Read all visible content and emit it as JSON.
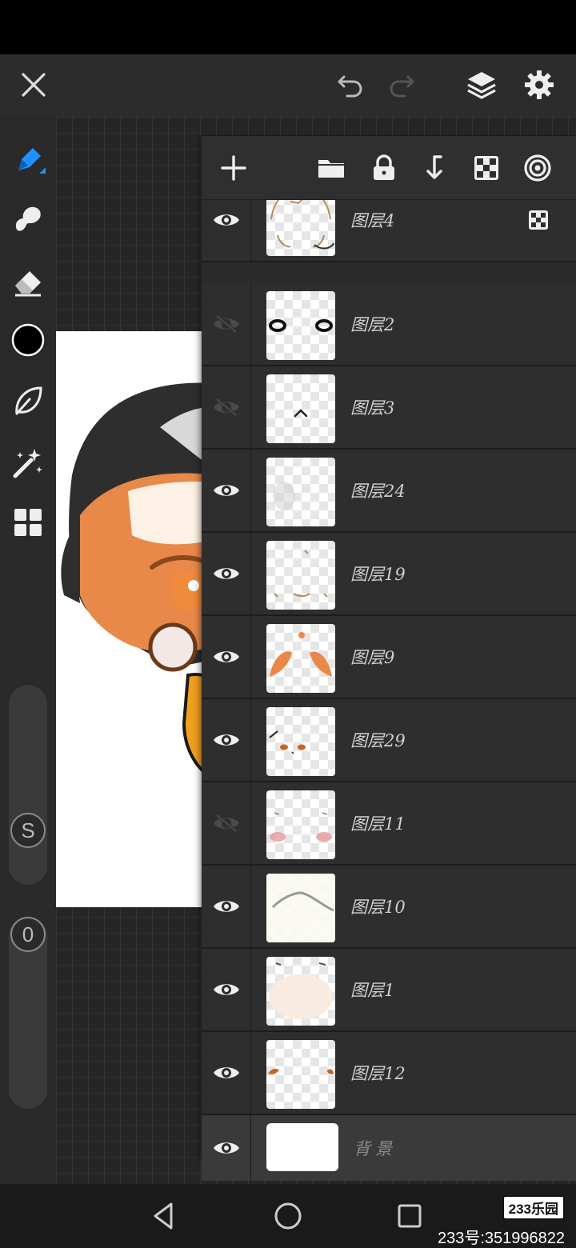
{
  "header": {
    "close_icon": "close-icon",
    "undo_icon": "undo-icon",
    "redo_icon": "redo-icon",
    "layers_icon": "layers-icon",
    "settings_icon": "gear-icon"
  },
  "tools": [
    "pen-icon",
    "smudge-icon",
    "eraser-icon",
    "color-swatch",
    "lasso-leaf-icon",
    "magic-wand-icon",
    "grid-icon"
  ],
  "brush_color": "#000000",
  "sliders": {
    "size_badge": "S",
    "opacity_badge": "0"
  },
  "layer_toolbar": [
    "add-icon",
    "folder-icon",
    "lock-icon",
    "merge-down-icon",
    "transparency-icon",
    "blend-icon"
  ],
  "layers": [
    {
      "name": "图层4",
      "visible": true
    },
    {
      "name": "图层2",
      "visible": false
    },
    {
      "name": "图层3",
      "visible": false
    },
    {
      "name": "图层24",
      "visible": true
    },
    {
      "name": "图层19",
      "visible": true
    },
    {
      "name": "图层9",
      "visible": true
    },
    {
      "name": "图层29",
      "visible": true
    },
    {
      "name": "图层11",
      "visible": false
    },
    {
      "name": "图层10",
      "visible": true
    },
    {
      "name": "图层1",
      "visible": true
    },
    {
      "name": "图层12",
      "visible": true
    },
    {
      "name": "背景",
      "visible": true
    }
  ],
  "watermark": {
    "logo": "233乐园",
    "id_text": "233号:351996822"
  },
  "colors": {
    "accent": "#1e90ff",
    "panel": "#2b2b2b",
    "skin": "#e8894a",
    "hair": "#2e2e2e"
  }
}
